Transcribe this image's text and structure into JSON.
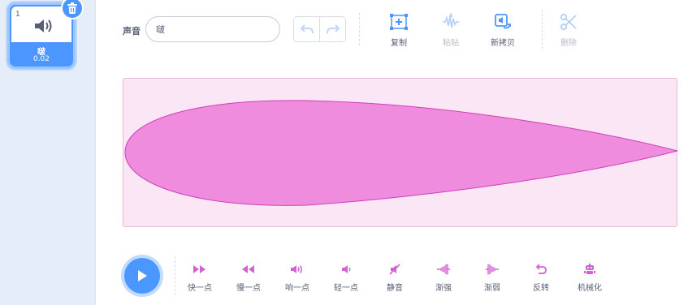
{
  "sound_list": {
    "items": [
      {
        "index": "1",
        "name": "啵",
        "duration": "0.02",
        "icon": "speaker-icon"
      }
    ],
    "delete_icon": "trash-icon"
  },
  "editor": {
    "sound_label": "声音",
    "sound_name_value": "啵",
    "undo_icon": "undo-icon",
    "redo_icon": "redo-icon",
    "tools": [
      {
        "label": "复制",
        "icon": "copy-icon",
        "enabled": true
      },
      {
        "label": "粘贴",
        "icon": "paste-icon",
        "enabled": false
      },
      {
        "label": "新拷贝",
        "icon": "new-copy-icon",
        "enabled": true
      },
      {
        "label": "删除",
        "icon": "scissors-icon",
        "enabled": false
      }
    ]
  },
  "effects": {
    "play_icon": "play-icon",
    "items": [
      {
        "label": "快一点",
        "icon": "faster-icon"
      },
      {
        "label": "慢一点",
        "icon": "slower-icon"
      },
      {
        "label": "响一点",
        "icon": "louder-icon"
      },
      {
        "label": "轻一点",
        "icon": "softer-icon"
      },
      {
        "label": "静音",
        "icon": "mute-icon"
      },
      {
        "label": "渐强",
        "icon": "fade-in-icon"
      },
      {
        "label": "渐弱",
        "icon": "fade-out-icon"
      },
      {
        "label": "反转",
        "icon": "reverse-icon"
      },
      {
        "label": "机械化",
        "icon": "robot-icon"
      }
    ]
  },
  "colors": {
    "accent": "#4c97ff",
    "waveform_fill": "#ef8cde",
    "waveform_stroke": "#cf3fb8",
    "waveform_bg": "#fbe6f5",
    "effect_icon": "#cf63cf"
  }
}
